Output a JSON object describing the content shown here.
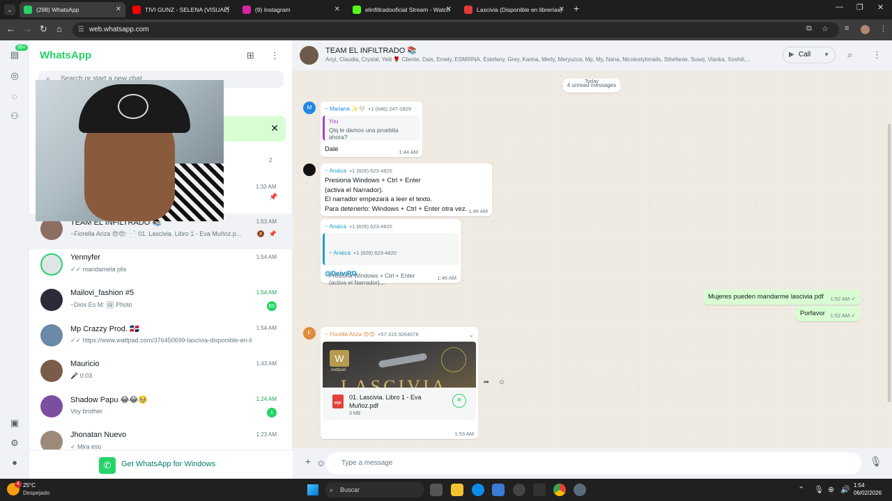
{
  "browser": {
    "tabs": [
      {
        "title": "(298) WhatsApp",
        "active": true
      },
      {
        "title": "TIVI GUNZ - SELENA (VISUAL)"
      },
      {
        "title": "(9) Instagram"
      },
      {
        "title": "elinfiltradooficial Stream - Watch"
      },
      {
        "title": "Lascivia (Disponible en librerías)"
      }
    ],
    "url": "web.whatsapp.com"
  },
  "rail": {
    "badge": "99+"
  },
  "left": {
    "title": "WhatsApp",
    "search_placeholder": "Search or start a new chat",
    "lone_count": "2",
    "lone_time": "1:33 AM",
    "chats": [
      {
        "name": "TEAM EL INFILTRADO 📚",
        "preview": "~Fiorella Ariza 😍😍: 📄 01. Lascivia. Libro 1 - Eva Muñoz.p...",
        "time": "1:53 AM",
        "selected": true,
        "muted": true,
        "pinned": true,
        "avatar_color": "#8d6e63"
      },
      {
        "name": "Yennyfer",
        "preview": "✓✓ mandamela plis",
        "time": "1:54 AM",
        "avatar_color": "#dfe5e7"
      },
      {
        "name": "Mailovi_fashion #5",
        "preview": "~Dios Es M: 🖼 Photo",
        "time": "1:54 AM",
        "badge": "60",
        "time_green": true,
        "avatar_color": "#2b2b3a"
      },
      {
        "name": "Mp Crazzy Prod. 🇩🇴",
        "preview": "✓✓ https://www.wattpad.com/376450699-lascivia-disponible-en-libre...",
        "time": "1:54 AM",
        "avatar_color": "#6b8aa8"
      },
      {
        "name": "Mauricio",
        "preview": "🎤 0:03",
        "time": "1:43 AM",
        "avatar_color": "#7a5c4a"
      },
      {
        "name": "Shadow Papu 😂😂🥹",
        "preview": "Voy brother",
        "time": "1:24 AM",
        "badge": "1",
        "time_green": true,
        "avatar_color": "#7b4fa0"
      },
      {
        "name": "Jhonatan Nuevo",
        "preview": "✓ Mira eso",
        "time": "1:23 AM",
        "avatar_color": "#9c8a7a"
      }
    ],
    "get_app": "Get WhatsApp for Windows"
  },
  "conversation": {
    "title": "TEAM EL INFILTRADO 📚",
    "members": "Anyi, Claudia, Crystal, Yeili 🌹 Cliente, Dais, Emely, ESMIRNA, Estefany, Grey, Karina, Merly, Meryuzca, Mp, My, Nana, Nicolestylonails, Sthefanie, Susej, Vianka, Xoshill,...",
    "call_label": "Call",
    "date_label": "Today",
    "unread_label": "4 unread messages",
    "messages": {
      "m1": {
        "sender": "~ Mariana ✨🤍",
        "phone": "+1 (646) 247-2829",
        "quote_name": "You",
        "quote_text": "Qlq le damos una pruebita ahora?",
        "text": "Dale",
        "time": "1:44 AM",
        "avatar_letter": "M"
      },
      "m2": {
        "sender": "~ Anaica",
        "phone": "+1 (829) 623-4820",
        "text": "Presiona Windows + Ctrl + Enter\n(activa el Narrador).\nEl narrador empezará a leer el texto.\nPara detenerlo: Windows + Ctrl + Enter otra vez.",
        "time": "1:46 AM"
      },
      "m3": {
        "sender": "~ Anaica",
        "phone": "+1 (829) 623-4820",
        "quote_name": "~ Anaica",
        "quote_phone": "+1 (829) 623-4820",
        "quote_text": "Presiona Windows + Ctrl + Enter\n(activa el Narrador)....",
        "text": "@DeiviRD",
        "time": "1:46 AM"
      },
      "out1": {
        "text": "Mujeres pueden mandarme lascivia pdf",
        "time": "1:52 AM"
      },
      "out2": {
        "text": "Porfavor",
        "time": "1:52 AM"
      },
      "m4": {
        "sender": "~ Fiorella Ariza 😍😍",
        "phone": "+57 315 3264078",
        "doc_name": "01. Lascivia. Libro 1 - Eva Muñoz.pdf",
        "doc_size": "3 MB",
        "doc_type": "PDF",
        "time": "1:53 AM",
        "avatar_letter": "F",
        "cover_brand": "W",
        "cover_sub": "wattpad",
        "cover_title": "LASCIVIA"
      }
    },
    "composer_placeholder": "Type a message"
  },
  "taskbar": {
    "temp": "25°C",
    "weather": "Despejado",
    "weather_badge": "4",
    "search": "Buscar",
    "time": "1:54",
    "date": "06/02/2026"
  }
}
